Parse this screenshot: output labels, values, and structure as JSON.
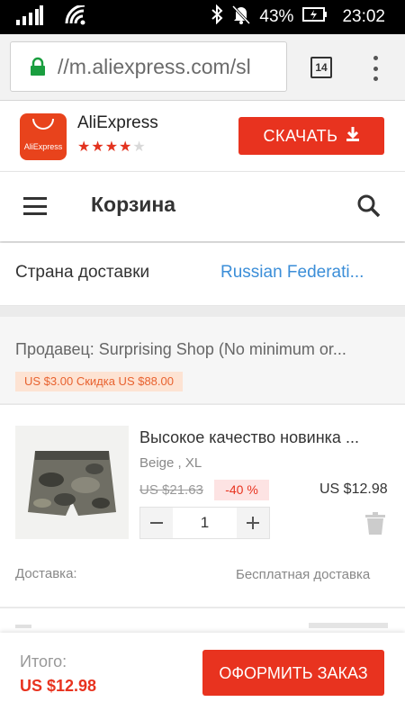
{
  "status_bar": {
    "battery": "43%",
    "time": "23:02"
  },
  "browser": {
    "url": "//m.aliexpress.com/sl",
    "tab_count": "14"
  },
  "app_banner": {
    "app_name": "AliExpress",
    "logo_text": "AliExpress",
    "rating_stars": "★★★★★",
    "download_label": "СКАЧАТЬ",
    "brand_color": "#e8331f"
  },
  "header": {
    "title": "Корзина"
  },
  "shipping": {
    "label": "Страна доставки",
    "country": "Russian Federati..."
  },
  "seller": {
    "name": "Продавец: Surprising Shop (No minimum or...",
    "promo": "US $3.00 Скидка US $88.00"
  },
  "product": {
    "title": "Высокое качество новинка ...",
    "variant": "Beige , XL",
    "old_price": "US $21.63",
    "discount": "-40 %",
    "price": "US $12.98",
    "quantity": "1",
    "delivery_label": "Доставка:",
    "delivery_value": "Бесплатная доставка"
  },
  "footer": {
    "total_label": "Итого:",
    "total_value": "US $12.98",
    "checkout_label": "ОФОРМИТЬ ЗАКАЗ"
  }
}
